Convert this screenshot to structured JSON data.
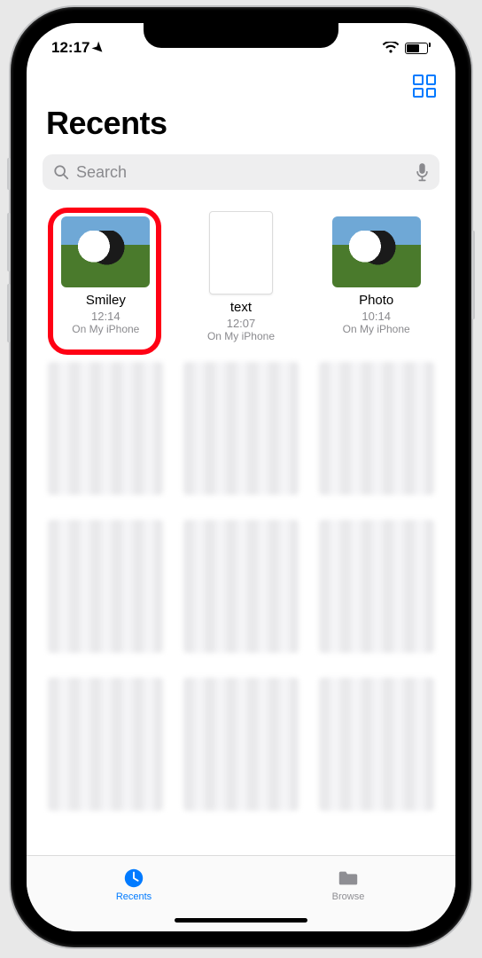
{
  "status": {
    "time": "12:17"
  },
  "header": {
    "title": "Recents"
  },
  "search": {
    "placeholder": "Search"
  },
  "files": [
    {
      "name": "Smiley",
      "time": "12:14",
      "location": "On My iPhone",
      "kind": "photo",
      "highlighted": true
    },
    {
      "name": "text",
      "time": "12:07",
      "location": "On My iPhone",
      "kind": "doc",
      "highlighted": false
    },
    {
      "name": "Photo",
      "time": "10:14",
      "location": "On My iPhone",
      "kind": "photo",
      "highlighted": false
    }
  ],
  "tabs": {
    "recents": "Recents",
    "browse": "Browse"
  }
}
